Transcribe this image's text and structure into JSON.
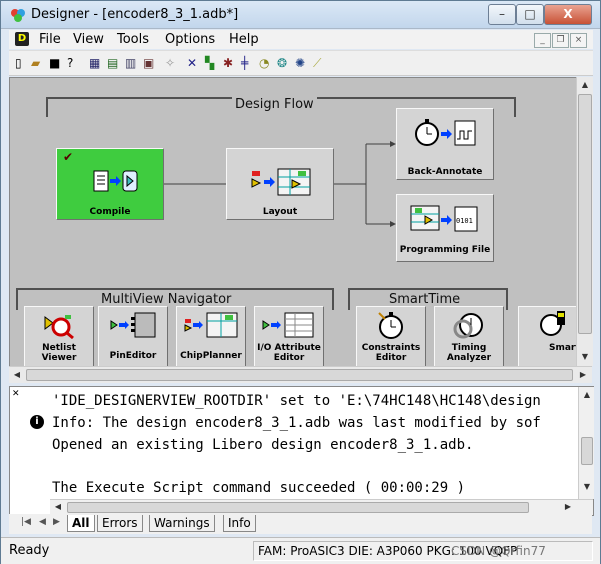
{
  "window": {
    "title": "Designer - [encoder8_3_1.adb*]",
    "min_label": "–",
    "max_label": "□",
    "close_label": "X"
  },
  "menu": {
    "items": [
      "File",
      "View",
      "Tools",
      "Options",
      "Help"
    ]
  },
  "mdi": {
    "min": "_",
    "restore": "❐",
    "close": "×"
  },
  "design_flow": {
    "title": "Design Flow",
    "compile": "Compile",
    "layout": "Layout",
    "back_annotate": "Back-Annotate",
    "programming_file": "Programming File"
  },
  "multiview": {
    "title": "MultiView Navigator",
    "items": [
      "Netlist Viewer",
      "PinEditor",
      "ChipPlanner",
      "I/O Attribute Editor"
    ]
  },
  "smarttime": {
    "title": "SmartTime",
    "items": [
      "Constraints Editor",
      "Timing Analyzer"
    ]
  },
  "smartpower": {
    "label": "Smart Power"
  },
  "log": {
    "lines": [
      "'IDE_DESIGNERVIEW_ROOTDIR' set to 'E:\\74HC148\\HC148\\design",
      "Info: The design encoder8_3_1.adb was last modified by sof",
      "Opened an existing Libero design encoder8_3_1.adb.",
      "",
      "The Execute Script command succeeded ( 00:00:29 )"
    ],
    "tabs": [
      "All",
      "Errors",
      "Warnings",
      "Info"
    ]
  },
  "status": {
    "ready": "Ready",
    "info": "FAM: ProASIC3  DIE: A3P060  PKG: 100 VQFP",
    "watermark": "CSDN @Qrfin77"
  },
  "colors": {
    "accent_active": "#3fcc3f",
    "canvas_bg": "#c0c0c0"
  }
}
